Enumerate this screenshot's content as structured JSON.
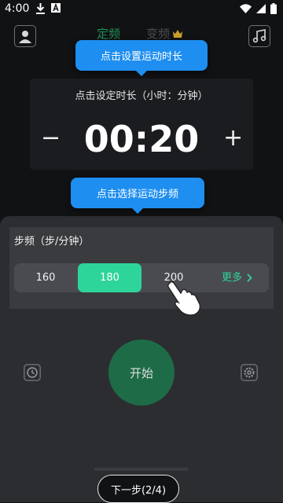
{
  "status_bar": {
    "time": "4:00"
  },
  "tabs": {
    "fixed": "定频",
    "variable": "变频"
  },
  "duration": {
    "tooltip": "点击设置运动时长",
    "label": "点击设定时长（小时：分钟）",
    "minus": "−",
    "value": "00:20",
    "plus": "+"
  },
  "cadence": {
    "tooltip": "点击选择运动步频",
    "label": "步频（步/分钟）",
    "options": [
      "160",
      "180",
      "200"
    ],
    "selected": "180",
    "more": "更多"
  },
  "actions": {
    "start": "开始"
  },
  "guide": {
    "next": "下一步(2/4)"
  },
  "colors": {
    "accent": "#2ed59a",
    "tooltip": "#1e8ef0",
    "start": "#1e6b48",
    "tab_active": "#1c8f55"
  },
  "icons": {
    "profile": "person-icon",
    "music": "music-note-icon",
    "crown": "crown-icon",
    "history": "history-icon",
    "settings": "gear-icon",
    "hand": "pointing-hand-icon"
  }
}
